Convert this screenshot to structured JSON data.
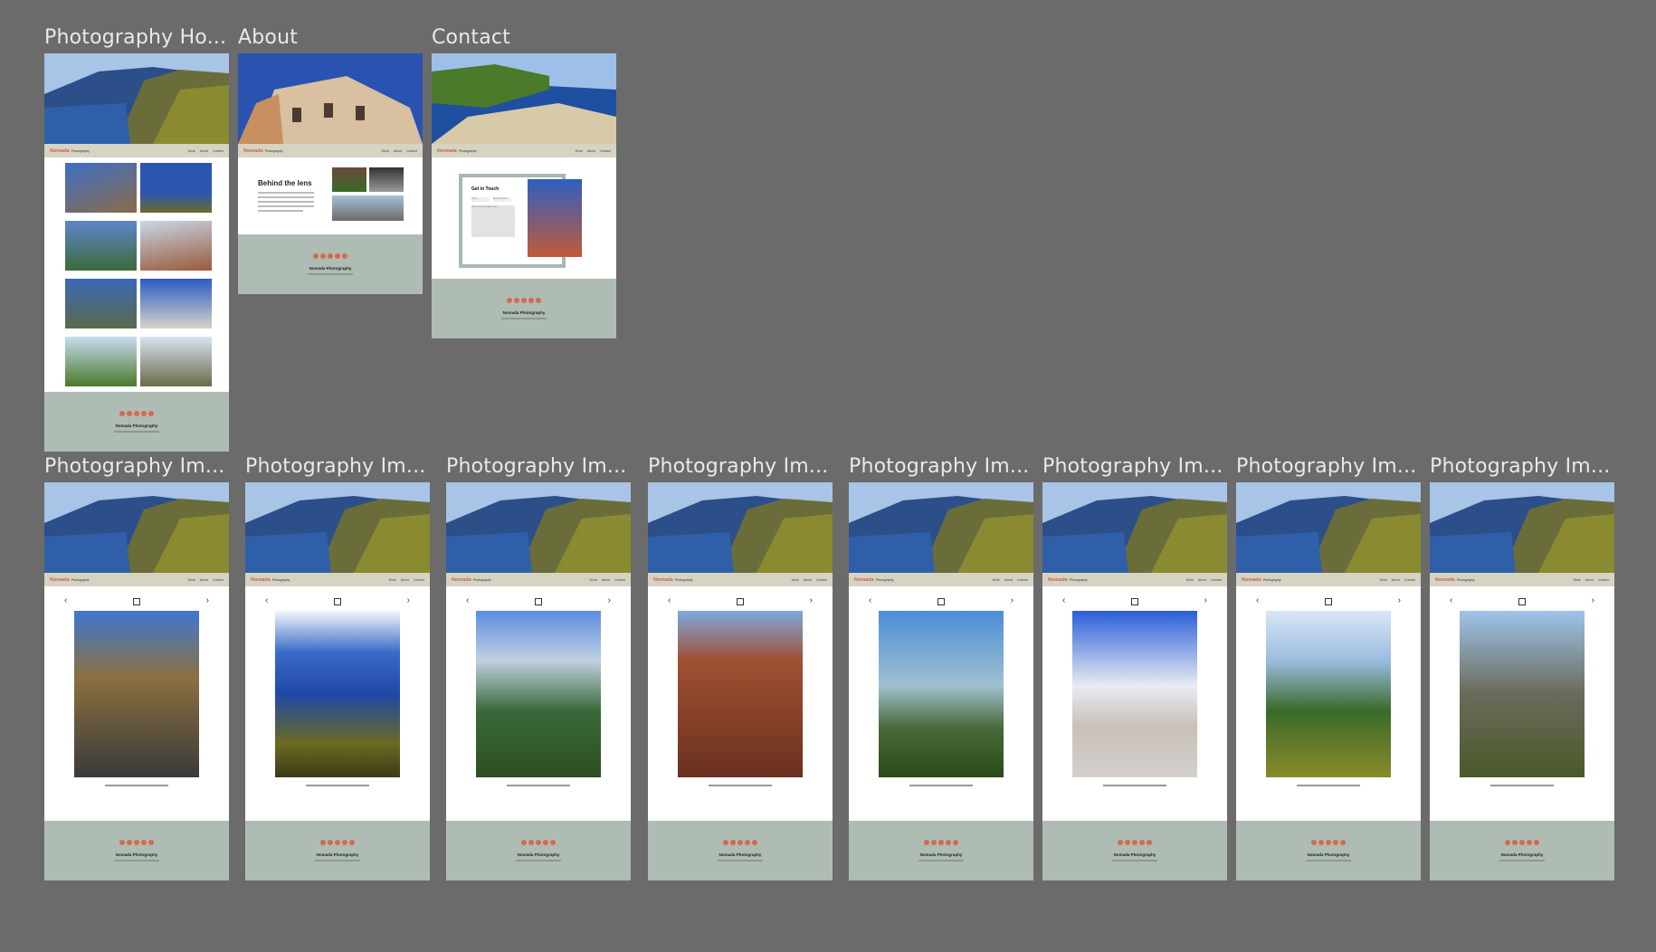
{
  "frames": [
    {
      "title": "Photography Ho..."
    },
    {
      "title": "About"
    },
    {
      "title": "Contact"
    },
    {
      "title": "Photography Im..."
    },
    {
      "title": "Photography Im..."
    },
    {
      "title": "Photography Im..."
    },
    {
      "title": "Photography Im..."
    },
    {
      "title": "Photography Im..."
    },
    {
      "title": "Photography Im..."
    },
    {
      "title": "Photography Im..."
    },
    {
      "title": "Photography Im..."
    }
  ],
  "site": {
    "brand_name": "Nomada",
    "brand_sub": "Photography",
    "nav": [
      "Work",
      "About",
      "Contact"
    ],
    "footer_name": "Nomada Photography"
  },
  "about": {
    "heading": "Behind the lens"
  },
  "contact": {
    "heading": "Get in Touch",
    "name_placeholder": "Name",
    "email_placeholder": "Email address",
    "message_placeholder": "Write your message here"
  },
  "viewer": {
    "prev_icon": "‹",
    "next_icon": "›"
  }
}
